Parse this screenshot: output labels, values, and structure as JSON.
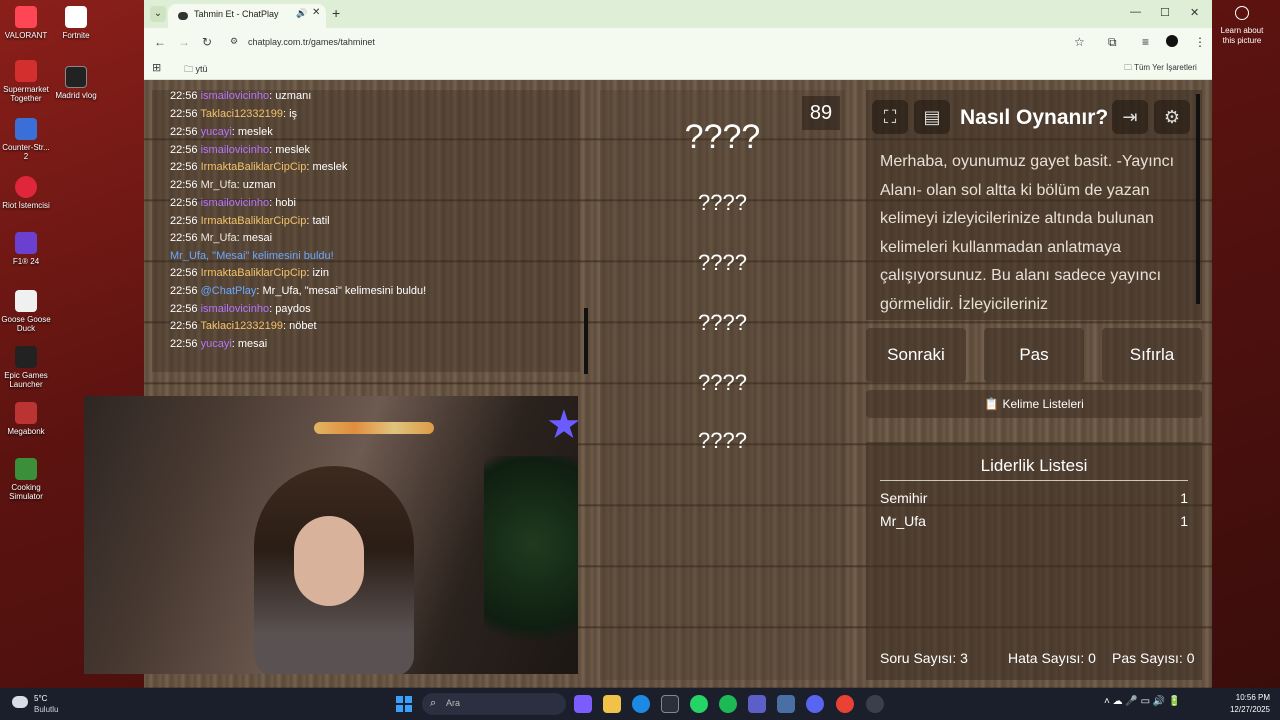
{
  "desktop": {
    "icons": [
      {
        "label": "VALORANT"
      },
      {
        "label": "Fortnite"
      },
      {
        "label": "Supermarket Together"
      },
      {
        "label": "Madrid vlog"
      },
      {
        "label": "Counter-Str... 2"
      },
      {
        "label": "Riot İstemcisi"
      },
      {
        "label": "F1® 24"
      },
      {
        "label": "Goose Goose Duck"
      },
      {
        "label": "Epic Games Launcher"
      },
      {
        "label": "Megabonk"
      },
      {
        "label": "Cooking Simulator"
      }
    ],
    "learn_label": "Learn about this picture"
  },
  "browser": {
    "tab_title": "Tahmin Et - ChatPlay",
    "url": "chatplay.com.tr/games/tahminet",
    "bookmark_folder": "ytü",
    "all_bookmarks": "Tüm Yer İşaretleri"
  },
  "chat": {
    "lines": [
      {
        "time": "22:56",
        "user": "ismailovicinho",
        "msg": ": uzmanı",
        "color": "purple"
      },
      {
        "time": "22:56",
        "user": "Taklaci12332199",
        "msg": ": iş",
        "color": "gold"
      },
      {
        "time": "22:56",
        "user": "yucayi",
        "msg": ": meslek",
        "color": "purple"
      },
      {
        "time": "22:56",
        "user": "ismailovicinho",
        "msg": ": meslek",
        "color": "purple"
      },
      {
        "time": "22:56",
        "user": "IrmaktaBaliklarCipCip",
        "msg": ": meslek",
        "color": "gold"
      },
      {
        "time": "22:56",
        "user": "Mr_Ufa",
        "msg": ": uzman",
        "color": "white"
      },
      {
        "time": "22:56",
        "user": "ismailovicinho",
        "msg": ": hobi",
        "color": "purple"
      },
      {
        "time": "22:56",
        "user": "IrmaktaBaliklarCipCip",
        "msg": ": tatil",
        "color": "gold"
      },
      {
        "time": "22:56",
        "user": "Mr_Ufa",
        "msg": ": mesai",
        "color": "white"
      },
      {
        "time": "",
        "user": "Mr_Ufa, \"Mesai\" kelimesini buldu!",
        "msg": "",
        "color": "blue"
      },
      {
        "time": "22:56",
        "user": "IrmaktaBaliklarCipCip",
        "msg": ": izin",
        "color": "gold"
      },
      {
        "time": "22:56",
        "user": "@ChatPlay",
        "msg": ": Mr_Ufa, \"mesai\" kelimesini buldu!",
        "color": "blue"
      },
      {
        "time": "22:56",
        "user": "ismailovicinho",
        "msg": ": paydos",
        "color": "purple"
      },
      {
        "time": "22:56",
        "user": "Taklaci12332199",
        "msg": ": nöbet",
        "color": "gold"
      },
      {
        "time": "22:56",
        "user": "yucayi",
        "msg": ": mesai",
        "color": "purple"
      }
    ]
  },
  "words": {
    "main": "????",
    "others": [
      "????",
      "????",
      "????",
      "????",
      "????"
    ],
    "timer": "89"
  },
  "howto": {
    "title": "Nasıl Oynanır?",
    "text": "Merhaba, oyunumuz gayet basit. -Yayıncı Alanı- olan sol altta ki bölüm de yazan kelimeyi izleyicilerinize altında bulunan kelimeleri kullanmadan anlatmaya çalışıyorsunuz. Bu alanı sadece yayıncı görmelidir. İzleyicileriniz"
  },
  "actions": {
    "next": "Sonraki",
    "pass": "Pas",
    "reset": "Sıfırla",
    "word_lists": "📋 Kelime Listeleri"
  },
  "leaderboard": {
    "title": "Liderlik Listesi",
    "rows": [
      {
        "name": "Semihir",
        "score": "1"
      },
      {
        "name": "Mr_Ufa",
        "score": "1"
      }
    ],
    "question_count": "Soru Sayısı: 3",
    "error_count": "Hata Sayısı: 0",
    "pass_count": "Pas Sayısı: 0"
  },
  "taskbar": {
    "weather_temp": "5°C",
    "weather_desc": "Bulutlu",
    "search_placeholder": "Ara",
    "time": "10:56 PM",
    "date": "12/27/2025"
  },
  "colors": {
    "chat_purple": "#b674ff",
    "chat_gold": "#f3c36a",
    "chat_blue": "#6aa8ff",
    "wood": "#6d5a48"
  }
}
